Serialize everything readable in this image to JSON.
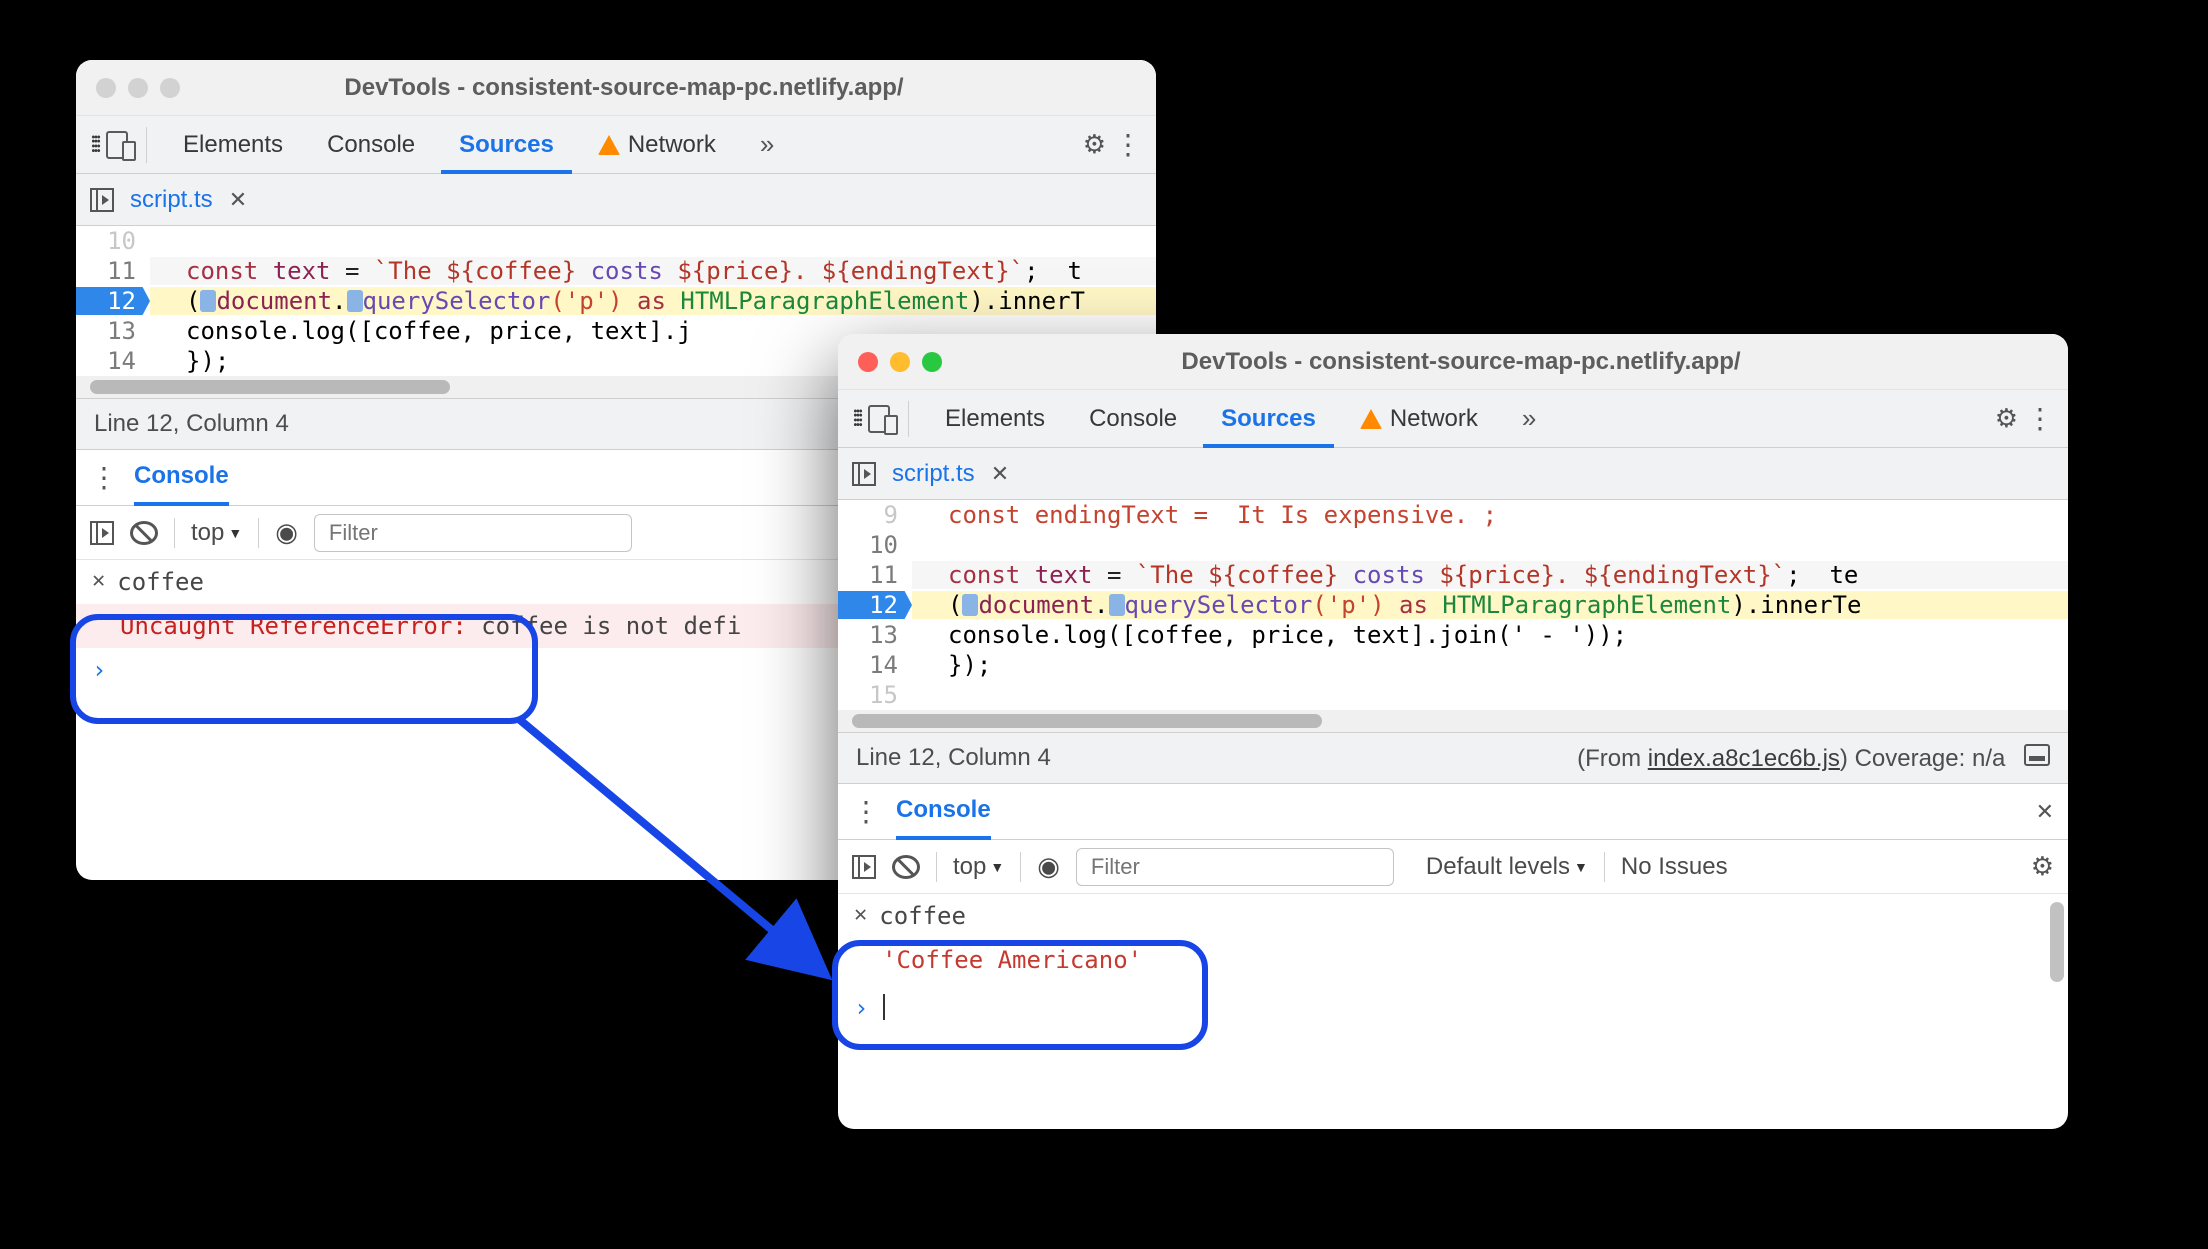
{
  "shared_title": "DevTools - consistent-source-map-pc.netlify.app/",
  "tabs": {
    "elements": "Elements",
    "console": "Console",
    "sources": "Sources",
    "network": "Network"
  },
  "file": {
    "name": "script.ts"
  },
  "code_left": {
    "l10": "10",
    "l11": {
      "num": "11",
      "pre": "const",
      "v1": " text ",
      "eq": "= ",
      "tpl": "`The ${coffee}",
      "cost": " costs ",
      "tpl2": "${price}. ${endingText}`",
      "trail": ";  t"
    },
    "l12": {
      "num": "12",
      "open": "(",
      "d": "document",
      "dot1": ".",
      "qs": "querySelector",
      "args": "('p')",
      "as": " as ",
      "type": "HTMLParagraphElement",
      "tail": ").innerT"
    },
    "l13": {
      "num": "13",
      "txt": "console.log([coffee, price, text].j"
    },
    "l14": {
      "num": "14",
      "txt": "});"
    }
  },
  "code_right": {
    "l9p": "const endingText =  It Is expensive. ;",
    "l10": "10",
    "l11": {
      "num": "11",
      "pre": "const",
      "v1": " text ",
      "eq": "= ",
      "tpl": "`The ${coffee}",
      "cost": " costs ",
      "tpl2": "${price}. ${endingText}`",
      "trail": ";  te"
    },
    "l12": {
      "num": "12",
      "open": "(",
      "d": "document",
      "dot1": ".",
      "qs": "querySelector",
      "args": "('p')",
      "as": " as ",
      "type": "HTMLParagraphElement",
      "tail": ").innerTe"
    },
    "l13": {
      "num": "13",
      "txt": "console.log([coffee, price, text].join(' - '));"
    },
    "l14": {
      "num": "14",
      "txt": "});"
    },
    "l15": "15"
  },
  "status_left": {
    "pos": "Line 12, Column 4",
    "from": "(From ",
    "link": "index.",
    "continued": ""
  },
  "status_right": {
    "pos": "Line 12, Column 4",
    "from": "(From ",
    "link": "index.a8c1ec6b.js",
    "cov": ") Coverage: n/a"
  },
  "drawer_label": "Console",
  "console_toolbar": {
    "context": "top",
    "filter_placeholder": "Filter",
    "levels": "Default levels",
    "defshort": "Def",
    "noissues": "No Issues"
  },
  "left_console": {
    "input": "coffee",
    "error": "Uncaught ReferenceError:",
    "error_tail": "coffee is not defi"
  },
  "right_console": {
    "input": "coffee",
    "output": "'Coffee Americano'"
  }
}
